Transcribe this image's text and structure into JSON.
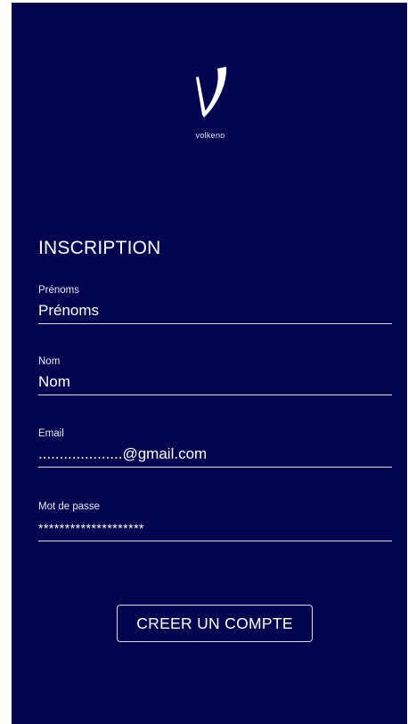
{
  "brand": {
    "logo_text": "volkeno"
  },
  "form": {
    "title": "INSCRIPTION",
    "fields": [
      {
        "label": "Prénoms",
        "value": "Prénoms"
      },
      {
        "label": "Nom",
        "value": "Nom"
      },
      {
        "label": "Email",
        "value": "....................@gmail.com"
      },
      {
        "label": "Mot de passe",
        "value": "********************"
      }
    ],
    "submit_label": "CREER UN COMPTE"
  },
  "colors": {
    "background": "#02044f",
    "text": "#ffffff"
  }
}
